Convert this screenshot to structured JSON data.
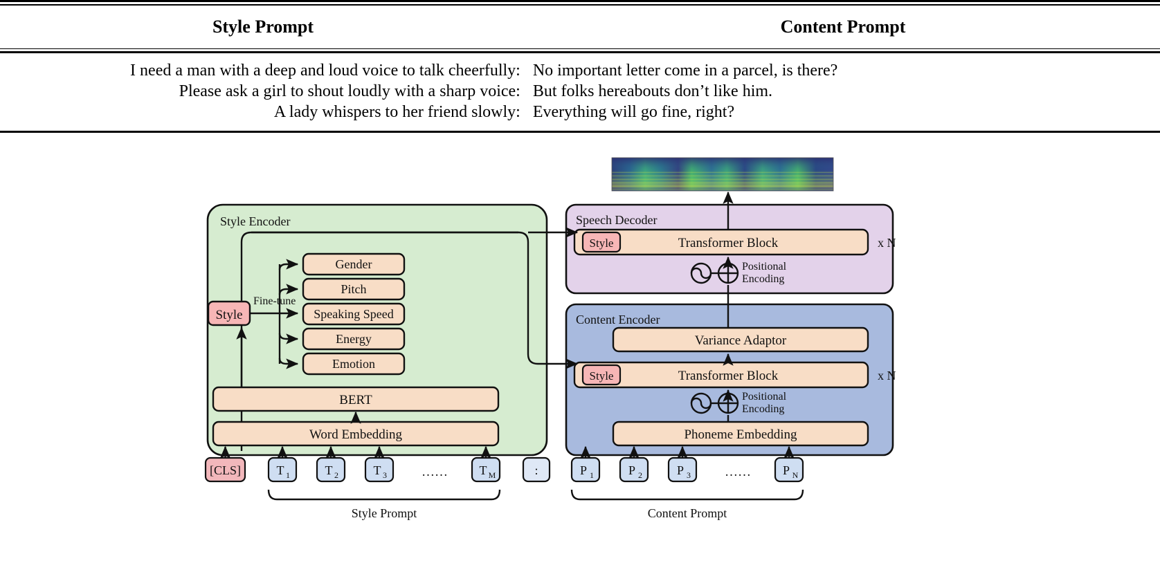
{
  "table": {
    "headers": {
      "style": "Style Prompt",
      "content": "Content Prompt"
    },
    "rows": [
      {
        "style": "I need a man with a deep and loud voice to talk cheerfully:",
        "content": "No important letter come in a parcel, is there?"
      },
      {
        "style": "Please ask a girl to shout loudly with a sharp voice:",
        "content": "But folks hereabouts don’t like him."
      },
      {
        "style": "A lady whispers to her friend slowly:",
        "content": "Everything will go fine, right?"
      }
    ]
  },
  "diagram": {
    "style_encoder": {
      "title": "Style Encoder",
      "style_token": "Style",
      "fine_tune_label": "Fine-tune",
      "attributes": [
        "Gender",
        "Pitch",
        "Speaking Speed",
        "Energy",
        "Emotion"
      ],
      "bert": "BERT",
      "word_embedding": "Word Embedding",
      "cls_token": "[CLS]",
      "tokens": [
        "T₁",
        "T₂",
        "T₃",
        "……",
        "T_M"
      ],
      "token_labels": [
        {
          "base": "T",
          "sub": "1"
        },
        {
          "base": "T",
          "sub": "2"
        },
        {
          "base": "T",
          "sub": "3"
        },
        {
          "base": "T",
          "sub": "M"
        }
      ],
      "ellipsis": "……",
      "bracket_label": "Style Prompt"
    },
    "speech_decoder": {
      "title": "Speech Decoder",
      "style_token": "Style",
      "transformer_block": "Transformer Block",
      "repeat": "x N",
      "positional_encoding_line1": "Positional",
      "positional_encoding_line2": "Encoding"
    },
    "content_encoder": {
      "title": "Content Encoder",
      "variance_adaptor": "Variance Adaptor",
      "style_token": "Style",
      "transformer_block": "Transformer Block",
      "repeat": "x N",
      "positional_encoding_line1": "Positional",
      "positional_encoding_line2": "Encoding",
      "phoneme_embedding": "Phoneme Embedding",
      "colon_token": ":",
      "token_labels": [
        {
          "base": "P",
          "sub": "1"
        },
        {
          "base": "P",
          "sub": "2"
        },
        {
          "base": "P",
          "sub": "3"
        },
        {
          "base": "P",
          "sub": "N"
        }
      ],
      "ellipsis": "……",
      "bracket_label": "Content Prompt"
    },
    "output": {
      "name": "mel-spectrogram"
    }
  },
  "colors": {
    "style_encoder_fill": "#d6ecd0",
    "speech_decoder_fill": "#e3d2ea",
    "content_encoder_fill": "#a8bade",
    "module_fill": "#f8ddc6",
    "style_token_fill": "#f7b6b6",
    "token_fill": "#cfdef2",
    "stroke": "#111111"
  }
}
